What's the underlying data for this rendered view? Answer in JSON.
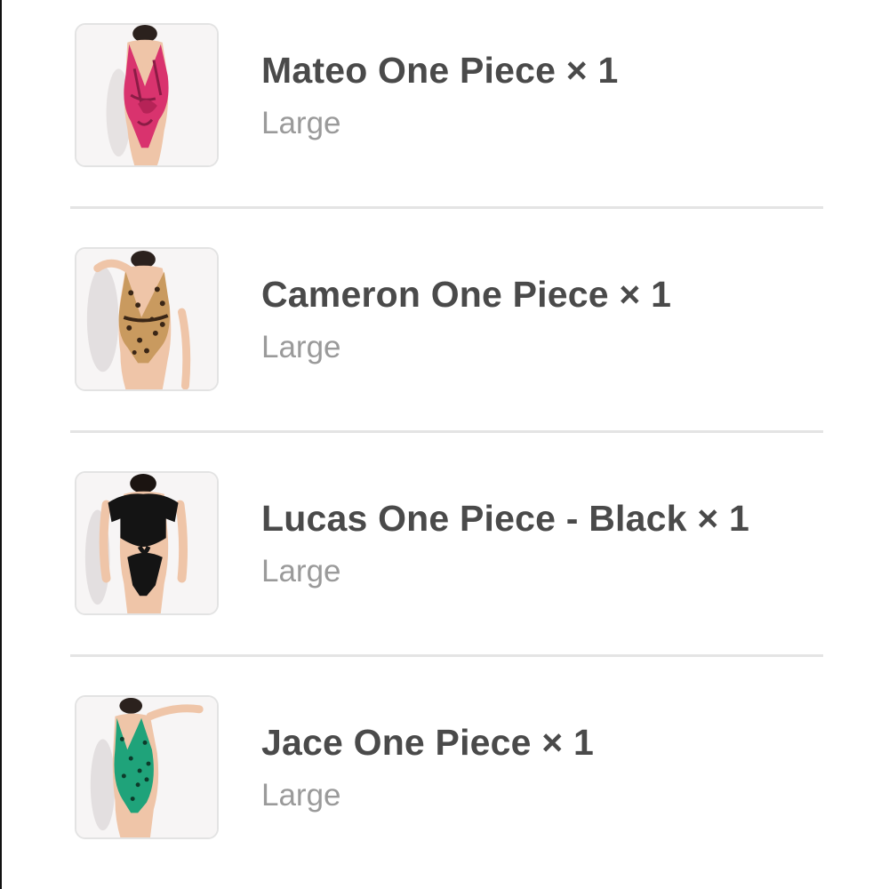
{
  "order": {
    "items": [
      {
        "name": "Mateo One Piece",
        "quantity": "× 1",
        "variant": "Large",
        "image_icon": "pink-snakeskin-swimsuit-photo",
        "swimsuit_color": "#d9336e"
      },
      {
        "name": "Cameron One Piece",
        "quantity": "× 1",
        "variant": "Large",
        "image_icon": "leopard-print-swimsuit-photo",
        "swimsuit_color": "#c99a5f"
      },
      {
        "name": "Lucas One Piece - Black",
        "quantity": "× 1",
        "variant": "Large",
        "image_icon": "black-cutout-swimsuit-photo",
        "swimsuit_color": "#141414"
      },
      {
        "name": "Jace One Piece",
        "quantity": "× 1",
        "variant": "Large",
        "image_icon": "green-leopard-swimsuit-photo",
        "swimsuit_color": "#1fa37a"
      }
    ]
  }
}
